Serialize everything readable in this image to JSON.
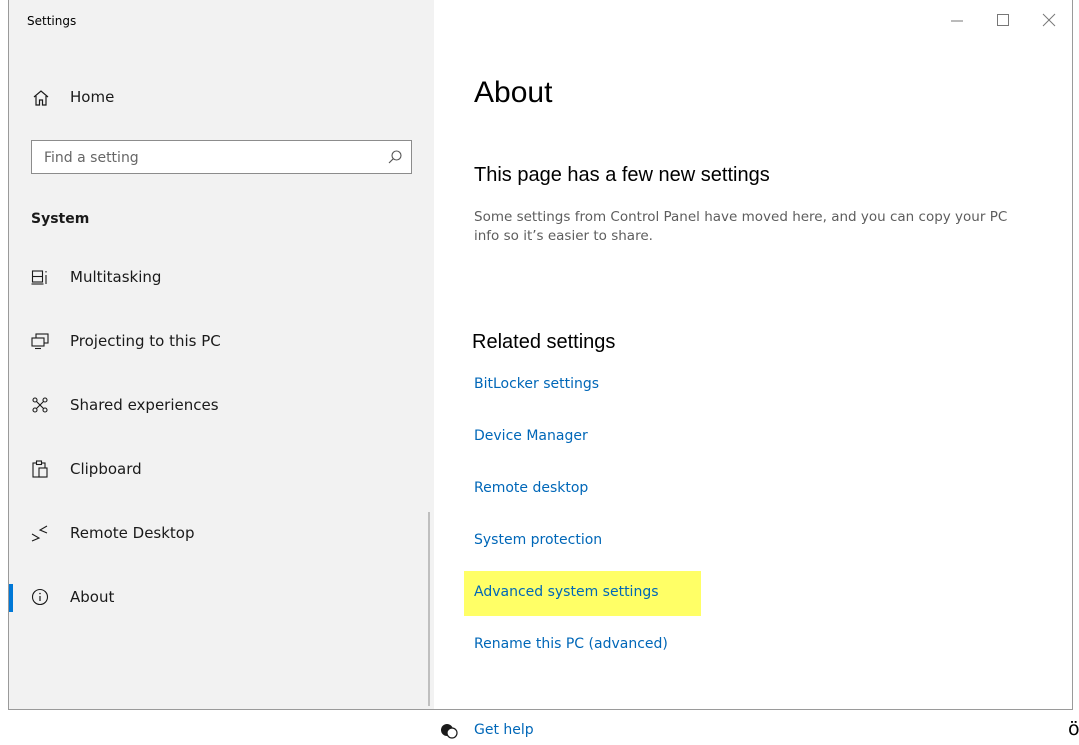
{
  "window": {
    "title": "Settings",
    "minimize_icon": "minimize-icon",
    "maximize_icon": "maximize-icon",
    "close_icon": "close-icon"
  },
  "sidebar": {
    "home_label": "Home",
    "search_placeholder": "Find a setting",
    "search_value": "",
    "section_title": "System",
    "items": [
      {
        "label": "Multitasking",
        "icon": "multitasking-icon"
      },
      {
        "label": "Projecting to this PC",
        "icon": "projecting-icon"
      },
      {
        "label": "Shared experiences",
        "icon": "shared-experiences-icon"
      },
      {
        "label": "Clipboard",
        "icon": "clipboard-icon"
      },
      {
        "label": "Remote Desktop",
        "icon": "remote-desktop-icon"
      },
      {
        "label": "About",
        "icon": "info-icon",
        "selected": true
      }
    ]
  },
  "main": {
    "title": "About",
    "notice_title": "This page has a few new settings",
    "notice_body": "Some settings from Control Panel have moved here, and you can copy your PC info so it’s easier to share.",
    "related_title": "Related settings",
    "related_links": [
      "BitLocker settings",
      "Device Manager",
      "Remote desktop",
      "System protection",
      "Advanced system settings",
      "Rename this PC (advanced)"
    ],
    "highlighted_link": "Advanced system settings",
    "help_label": "Get help"
  },
  "colors": {
    "accent": "#0078d7",
    "link": "#0067b8",
    "highlight": "#ffff66",
    "sidebar_bg": "#f2f2f2"
  },
  "stray_text": "ö"
}
